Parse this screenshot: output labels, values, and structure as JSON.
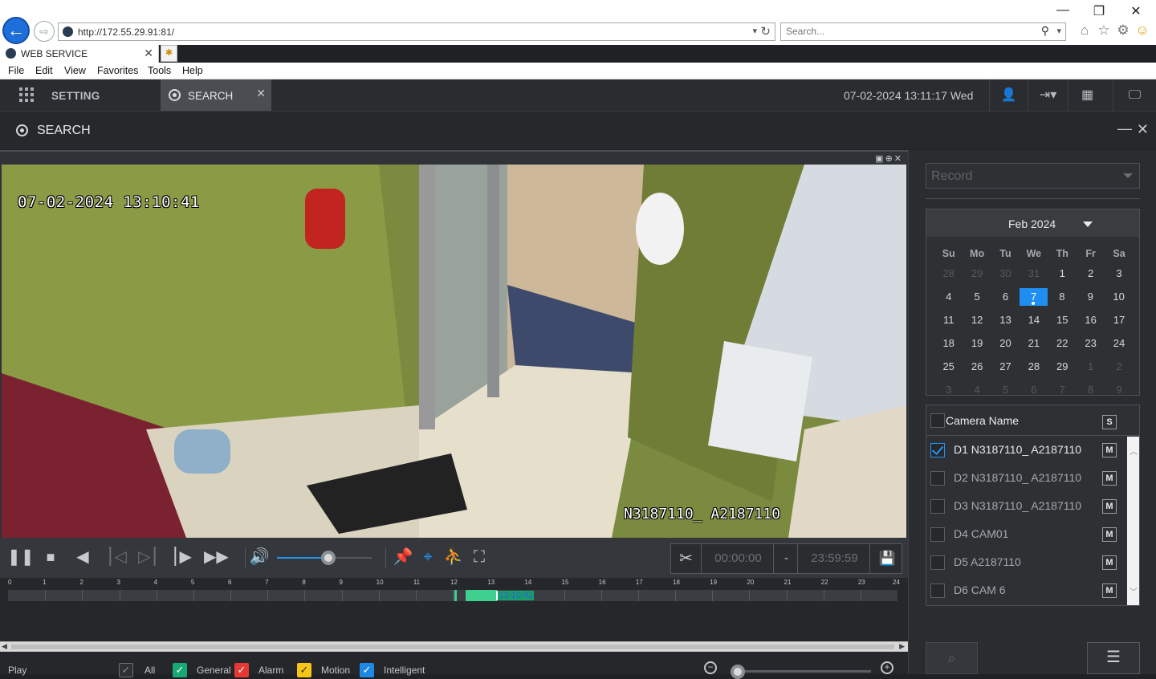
{
  "browser": {
    "url": "http://172.55.29.91:81/",
    "search_placeholder": "Search...",
    "tab_title": "WEB SERVICE",
    "menu": [
      "File",
      "Edit",
      "View",
      "Favorites",
      "Tools",
      "Help"
    ]
  },
  "app": {
    "setting_label": "SETTING",
    "search_tab_label": "SEARCH",
    "datetime": "07-02-2024 13:11:17 Wed",
    "panel_title": "SEARCH"
  },
  "video": {
    "osd_time": "07-02-2024 13:10:41",
    "osd_camera": "N3187110_ A2187110",
    "volume_level": 0.54
  },
  "clip": {
    "start": "00:00:00",
    "separator": "-",
    "end": "23:59:59"
  },
  "timeline": {
    "hours": [
      "0",
      "1",
      "2",
      "3",
      "4",
      "5",
      "6",
      "7",
      "8",
      "9",
      "10",
      "11",
      "12",
      "13",
      "14",
      "15",
      "16",
      "17",
      "18",
      "19",
      "20",
      "21",
      "22",
      "23",
      "24"
    ],
    "current_time": "13:10:41",
    "recorded_segments": [
      [
        12.05,
        12.1
      ],
      [
        12.35,
        12.4
      ],
      [
        12.4,
        13.2
      ]
    ],
    "cursor_hour": 13.18
  },
  "legend": {
    "play_label": "Play",
    "items": [
      {
        "label": "All",
        "color": "#2e3034",
        "check": "#8b8f94"
      },
      {
        "label": "General",
        "color": "#19a974",
        "check": "#ffffff"
      },
      {
        "label": "Alarm",
        "color": "#e53935",
        "check": "#ffffff"
      },
      {
        "label": "Motion",
        "color": "#f5c518",
        "check": "#333333"
      },
      {
        "label": "Intelligent",
        "color": "#1e88e5",
        "check": "#ffffff"
      }
    ]
  },
  "right_panel": {
    "record_type": "Record",
    "calendar": {
      "month_label": "Feb 2024",
      "dow": [
        "Su",
        "Mo",
        "Tu",
        "We",
        "Th",
        "Fr",
        "Sa"
      ],
      "weeks": [
        [
          {
            "d": "28",
            "m": true
          },
          {
            "d": "29",
            "m": true
          },
          {
            "d": "30",
            "m": true
          },
          {
            "d": "31",
            "m": true
          },
          {
            "d": "1"
          },
          {
            "d": "2"
          },
          {
            "d": "3"
          }
        ],
        [
          {
            "d": "4"
          },
          {
            "d": "5"
          },
          {
            "d": "6"
          },
          {
            "d": "7",
            "s": true
          },
          {
            "d": "8"
          },
          {
            "d": "9"
          },
          {
            "d": "10"
          }
        ],
        [
          {
            "d": "11"
          },
          {
            "d": "12"
          },
          {
            "d": "13"
          },
          {
            "d": "14"
          },
          {
            "d": "15"
          },
          {
            "d": "16"
          },
          {
            "d": "17"
          }
        ],
        [
          {
            "d": "18"
          },
          {
            "d": "19"
          },
          {
            "d": "20"
          },
          {
            "d": "21"
          },
          {
            "d": "22"
          },
          {
            "d": "23"
          },
          {
            "d": "24"
          }
        ],
        [
          {
            "d": "25"
          },
          {
            "d": "26"
          },
          {
            "d": "27"
          },
          {
            "d": "28"
          },
          {
            "d": "29"
          },
          {
            "d": "1",
            "m": true
          },
          {
            "d": "2",
            "m": true
          }
        ],
        [
          {
            "d": "3",
            "m": true
          },
          {
            "d": "4",
            "m": true
          },
          {
            "d": "5",
            "m": true
          },
          {
            "d": "6",
            "m": true
          },
          {
            "d": "7",
            "m": true
          },
          {
            "d": "8",
            "m": true
          },
          {
            "d": "9",
            "m": true
          }
        ]
      ]
    },
    "camera_header": "Camera Name",
    "s_label": "S",
    "m_label": "M",
    "cameras": [
      {
        "name": "D1 N3187110_ A2187110",
        "checked": true
      },
      {
        "name": "D2 N3187110_ A2187110",
        "checked": false
      },
      {
        "name": "D3 N3187110_ A2187110",
        "checked": false
      },
      {
        "name": "D4 CAM01",
        "checked": false
      },
      {
        "name": "D5 A2187110",
        "checked": false
      },
      {
        "name": "D6 CAM 6",
        "checked": false
      }
    ]
  }
}
